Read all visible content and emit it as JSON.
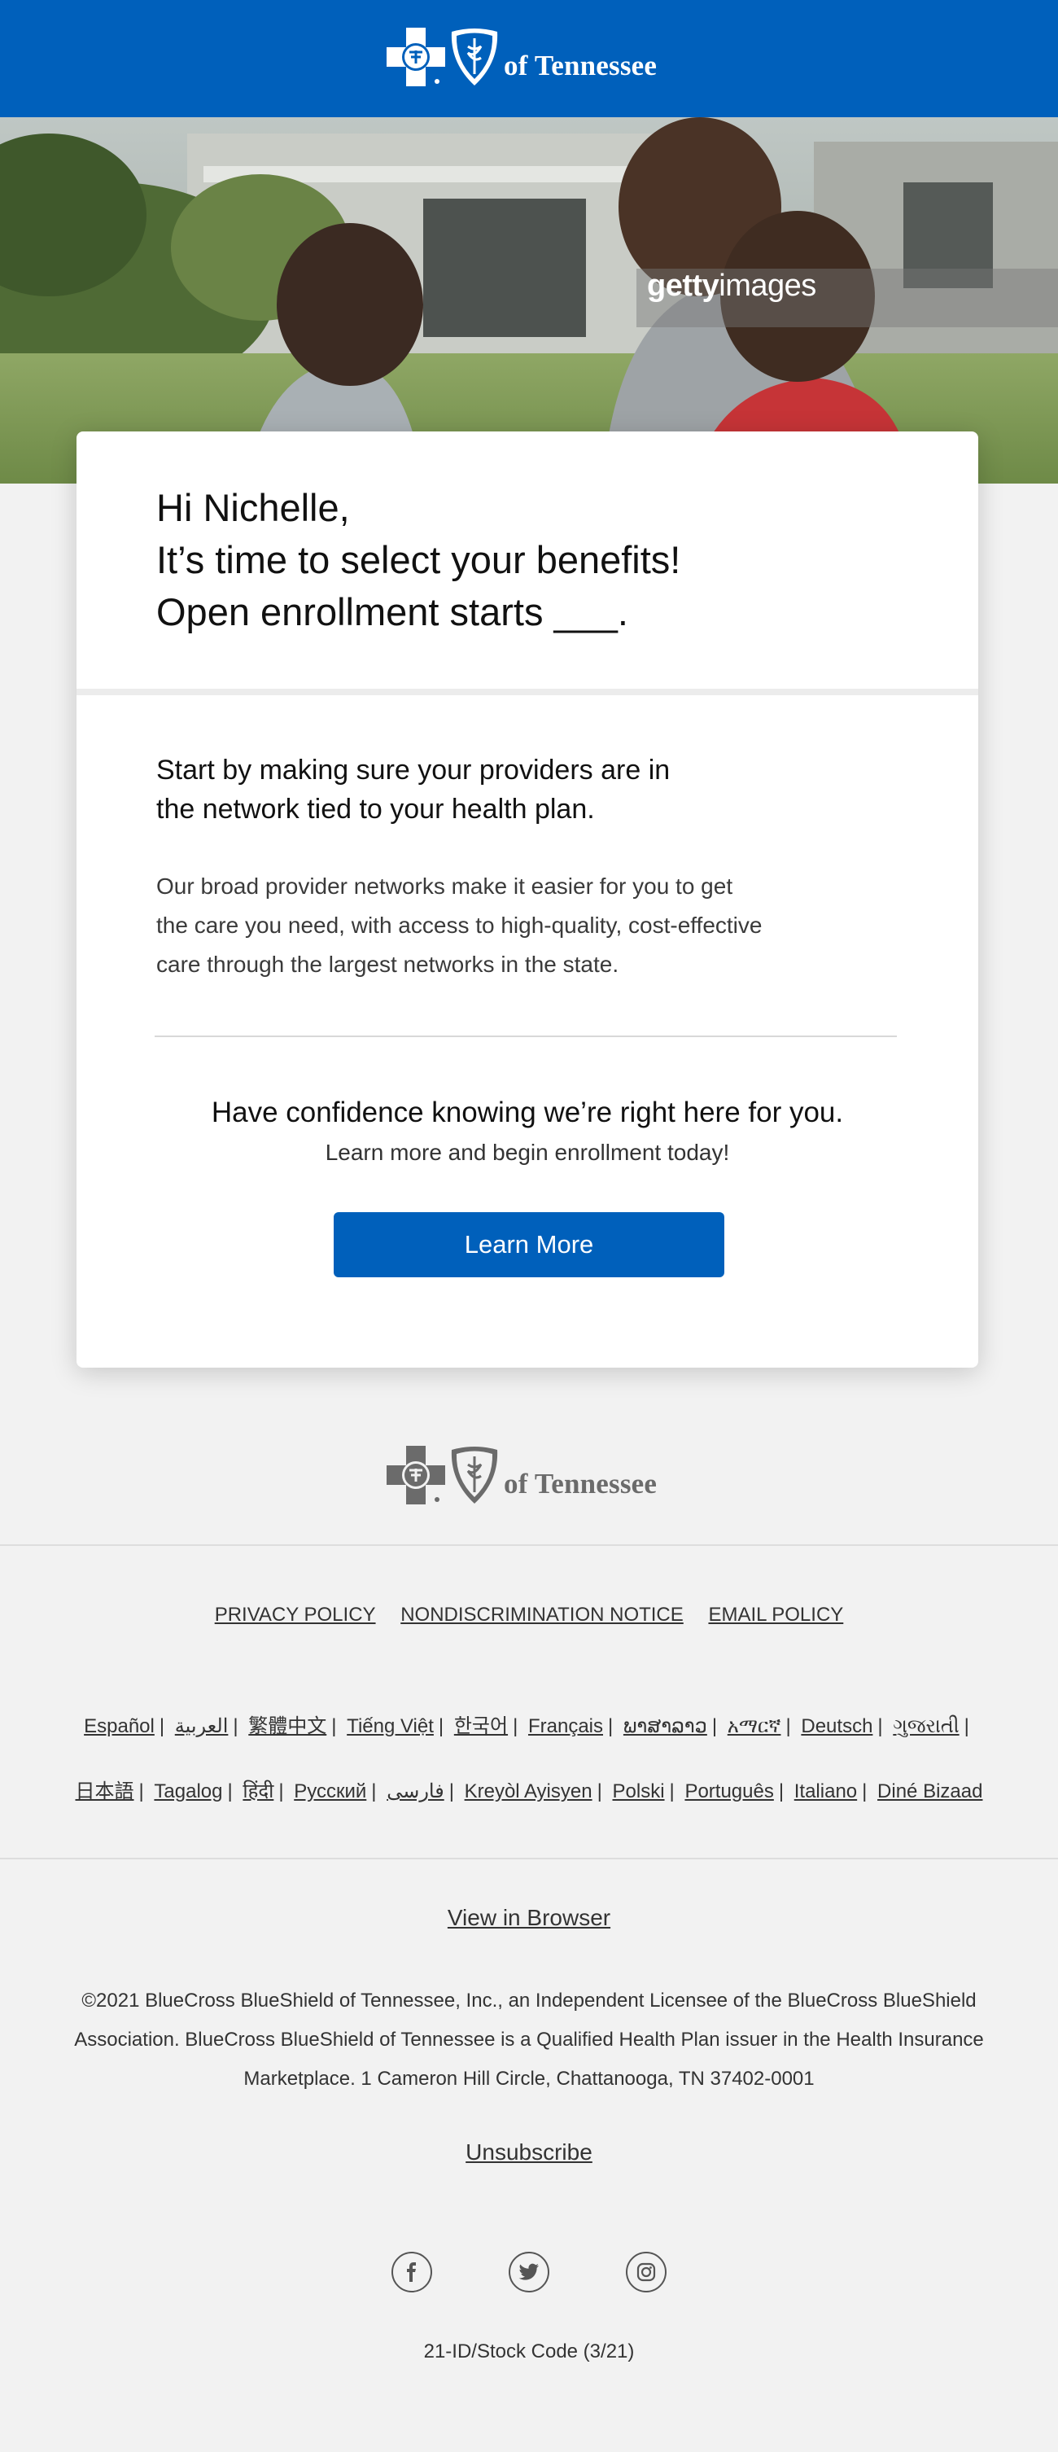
{
  "brand": {
    "logo_text": "of Tennessee",
    "primary_color": "#0060bb",
    "footer_logo_color": "#6b6b6b"
  },
  "hero": {
    "icon": "family-photo",
    "watermark_bold": "getty",
    "watermark_light": "images"
  },
  "card": {
    "greeting": [
      "Hi Nichelle,",
      "It’s time to select your benefits!",
      "Open enrollment starts ___."
    ],
    "providers_heading": [
      "Start by making sure your providers are in",
      "the network tied to your health plan."
    ],
    "providers_body": [
      "Our broad provider networks make it easier for you to get",
      "the care you need, with access to high-quality, cost-effective",
      "care through the largest networks in the state."
    ],
    "confidence": "Have confidence knowing we’re right here for you.",
    "learn_sub": "Learn more and begin enrollment today!",
    "cta_label": "Learn More"
  },
  "footer": {
    "policies": [
      "PRIVACY POLICY",
      "NONDISCRIMINATION NOTICE",
      "EMAIL POLICY"
    ],
    "languages_row1": [
      "Español",
      "العربية",
      "繁體中文",
      "Tiếng Việt",
      "한국어",
      "Français",
      "ພາສາລາວ",
      "አማርኛ",
      "Deutsch",
      "ગુજરાતી"
    ],
    "languages_row2": [
      "日本語",
      "Tagalog",
      "हिंदी",
      "Русский",
      "فارسی",
      "Kreyòl Ayisyen",
      "Polski",
      "Português",
      "Italiano",
      "Diné Bizaad"
    ],
    "view_in_browser": "View in Browser",
    "copyright_lines": [
      "©2021 BlueCross BlueShield of Tennessee, Inc., an Independent Licensee of the BlueCross BlueShield",
      "Association. BlueCross BlueShield of Tennessee is a Qualified Health Plan issuer in the Health Insurance",
      "Marketplace. 1 Cameron Hill Circle, Chattanooga, TN 37402-0001"
    ],
    "unsubscribe": "Unsubscribe",
    "social": [
      "facebook-icon",
      "twitter-icon",
      "instagram-icon"
    ],
    "stock_code": "21-ID/Stock Code (3/21)"
  }
}
